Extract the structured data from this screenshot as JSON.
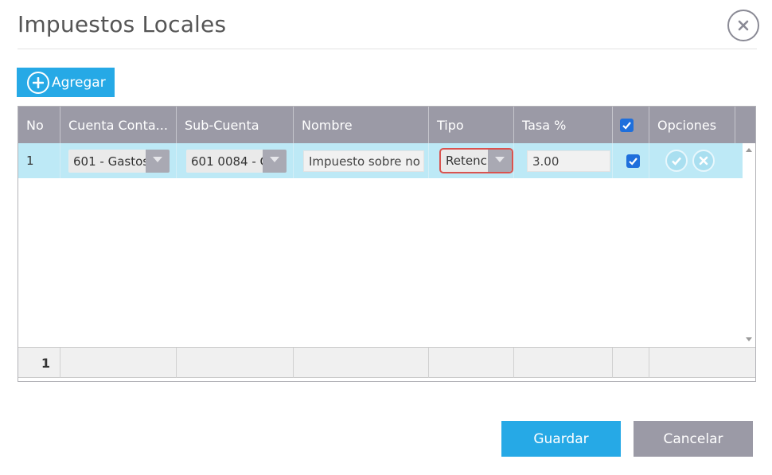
{
  "dialog": {
    "title": "Impuestos Locales",
    "close_icon": "close-circle-icon"
  },
  "toolbar": {
    "add_label": "Agregar",
    "add_icon": "plus-circle-icon"
  },
  "grid": {
    "columns": [
      "No",
      "Cuenta Conta...",
      "Sub-Cuenta",
      "Nombre",
      "Tipo",
      "Tasa %",
      "",
      "Opciones"
    ],
    "header_checkbox_checked": true,
    "rows": [
      {
        "no": "1",
        "cuenta": "601 - Gastos",
        "subcuenta": "601 0084 - C",
        "nombre": "Impuesto sobre no",
        "tipo": "Retenc",
        "tasa": "3.00",
        "checked": true
      }
    ],
    "footer_count": "1"
  },
  "actions": {
    "save_label": "Guardar",
    "cancel_label": "Cancelar"
  },
  "colors": {
    "accent": "#26a9e6",
    "header_bg": "#9b9aa6",
    "selected_row": "#bde9f6",
    "invalid_border": "#d9534f",
    "checkbox": "#1e6fdc"
  }
}
